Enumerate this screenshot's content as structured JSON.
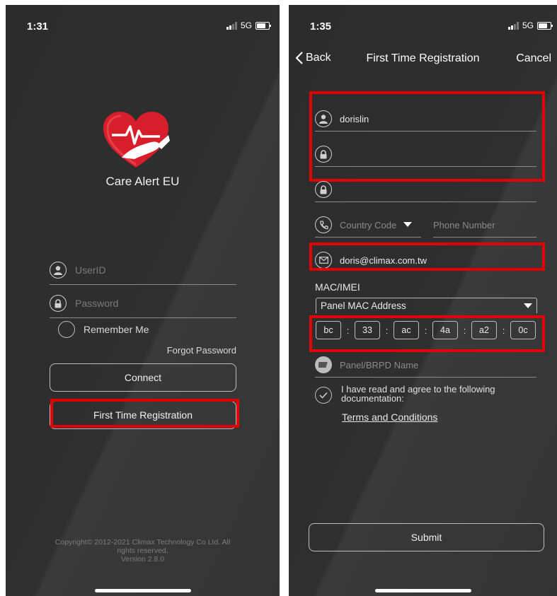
{
  "left": {
    "status_time": "1:31",
    "network": "5G",
    "app_name": "Care Alert EU",
    "userid_placeholder": "UserID",
    "password_placeholder": "Password",
    "remember_label": "Remember Me",
    "forgot_label": "Forgot Password",
    "connect_label": "Connect",
    "register_label": "First Time Registration",
    "copyright_line1": "Copyright© 2012-2021 Climax Technology Co Ltd. All",
    "copyright_line2": "rights reserved.",
    "version": "Version 2.8.0"
  },
  "right": {
    "status_time": "1:35",
    "network": "5G",
    "back_label": "Back",
    "title": "First Time Registration",
    "cancel_label": "Cancel",
    "username_value": "dorislin",
    "country_code_placeholder": "Country Code",
    "phone_placeholder": "Phone Number",
    "email_value": "doris@climax.com.tw",
    "mac_label": "MAC/IMEI",
    "mac_select_value": "Panel MAC Address",
    "mac_parts": [
      "bc",
      "33",
      "ac",
      "4a",
      "a2",
      "0c"
    ],
    "panel_name_placeholder": "Panel/BRPD Name",
    "agree_line1": "I have read and agree to the following",
    "agree_line2": "documentation:",
    "terms_label": "Terms and Conditions",
    "submit_label": "Submit"
  },
  "colors": {
    "background": "#2e2e2e",
    "highlight": "#e00000",
    "logo_red": "#d81e2a"
  }
}
